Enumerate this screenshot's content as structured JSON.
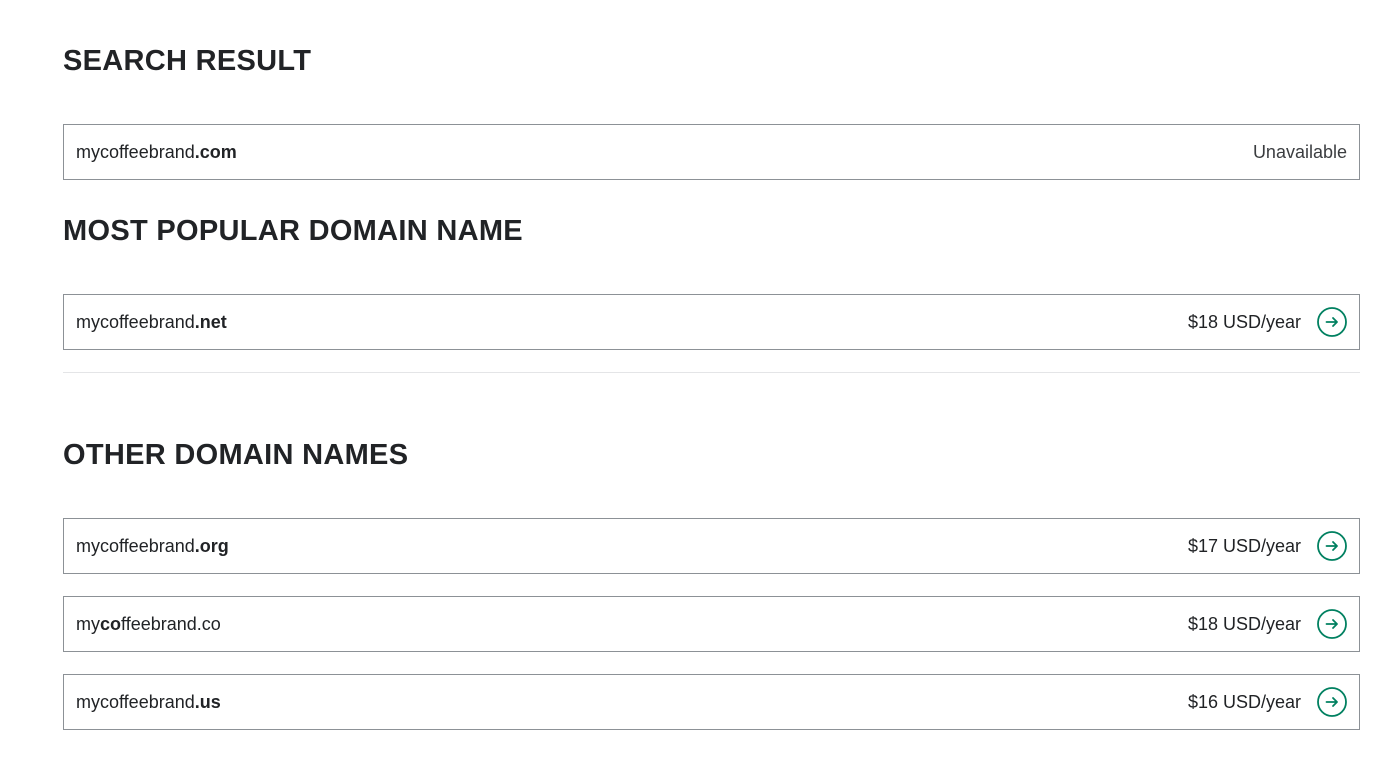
{
  "colors": {
    "text": "#212326",
    "border": "#8c9196",
    "accent": "#008060",
    "divider": "#e4e5e7"
  },
  "search_result": {
    "heading": "SEARCH RESULT",
    "row": {
      "prefix": "mycoffeebrand",
      "bold": ".com",
      "suffix": "",
      "status": "Unavailable"
    }
  },
  "most_popular": {
    "heading": "MOST POPULAR DOMAIN NAME",
    "row": {
      "prefix": "mycoffeebrand",
      "bold": ".net",
      "suffix": "",
      "price": "$18 USD/year",
      "icon": "arrow-right-circle-icon"
    }
  },
  "other": {
    "heading": "OTHER DOMAIN NAMES",
    "rows": [
      {
        "prefix": "mycoffeebrand",
        "bold": ".org",
        "suffix": "",
        "price": "$17 USD/year",
        "icon": "arrow-right-circle-icon"
      },
      {
        "prefix": "my",
        "bold": "co",
        "suffix": "ffeebrand.co",
        "price": "$18 USD/year",
        "icon": "arrow-right-circle-icon"
      },
      {
        "prefix": "mycoffeebrand",
        "bold": ".us",
        "suffix": "",
        "price": "$16 USD/year",
        "icon": "arrow-right-circle-icon"
      }
    ]
  }
}
